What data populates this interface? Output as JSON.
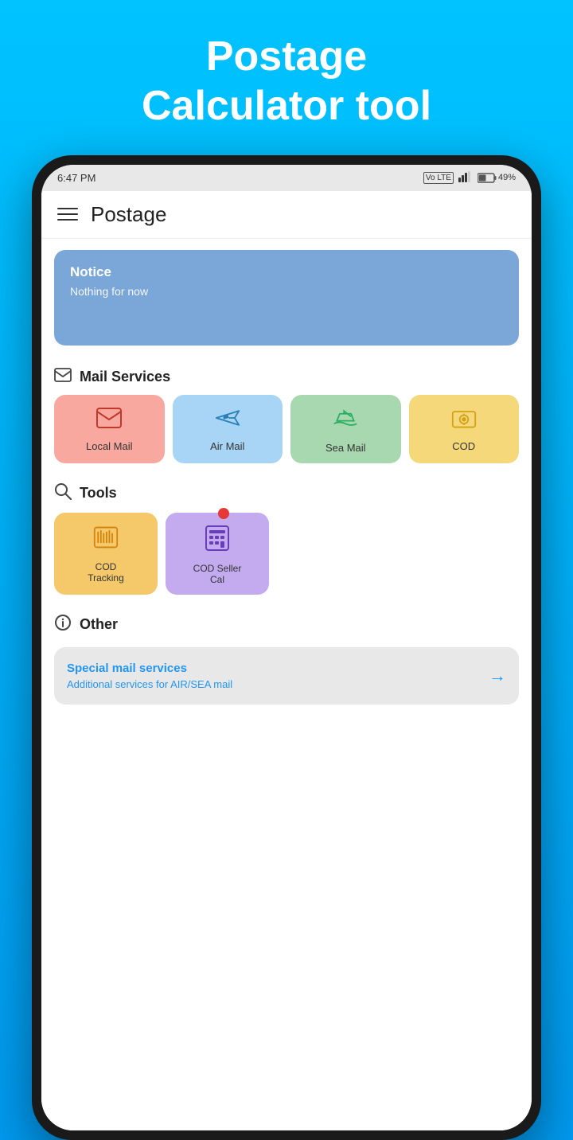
{
  "app": {
    "background_title": "Postage\nCalculator tool"
  },
  "status_bar": {
    "time": "6:47 PM",
    "signal": "▐▐▐▌",
    "battery": "49%",
    "lte": "Vo LTE"
  },
  "nav": {
    "title": "Postage"
  },
  "notice": {
    "title": "Notice",
    "body": "Nothing for now"
  },
  "mail_services": {
    "section_label": "Mail Services",
    "items": [
      {
        "id": "local-mail",
        "label": "Local Mail",
        "color": "local",
        "icon": "✉️"
      },
      {
        "id": "air-mail",
        "label": "Air Mail",
        "color": "air",
        "icon": "✈"
      },
      {
        "id": "sea-mail",
        "label": "Sea Mail",
        "color": "sea",
        "icon": "🚢"
      },
      {
        "id": "cod",
        "label": "COD",
        "color": "cod",
        "icon": "💰"
      }
    ]
  },
  "tools": {
    "section_label": "Tools",
    "items": [
      {
        "id": "cod-tracking",
        "label": "COD\nTracking",
        "color": "cod-tracking",
        "icon": "📊"
      },
      {
        "id": "cod-seller",
        "label": "COD Seller\nCal",
        "color": "cod-seller",
        "icon": "🧮",
        "has_dot": true
      }
    ]
  },
  "other": {
    "section_label": "Other",
    "card": {
      "title": "Special mail services",
      "subtitle": "Additional services for AIR/SEA mail"
    }
  }
}
